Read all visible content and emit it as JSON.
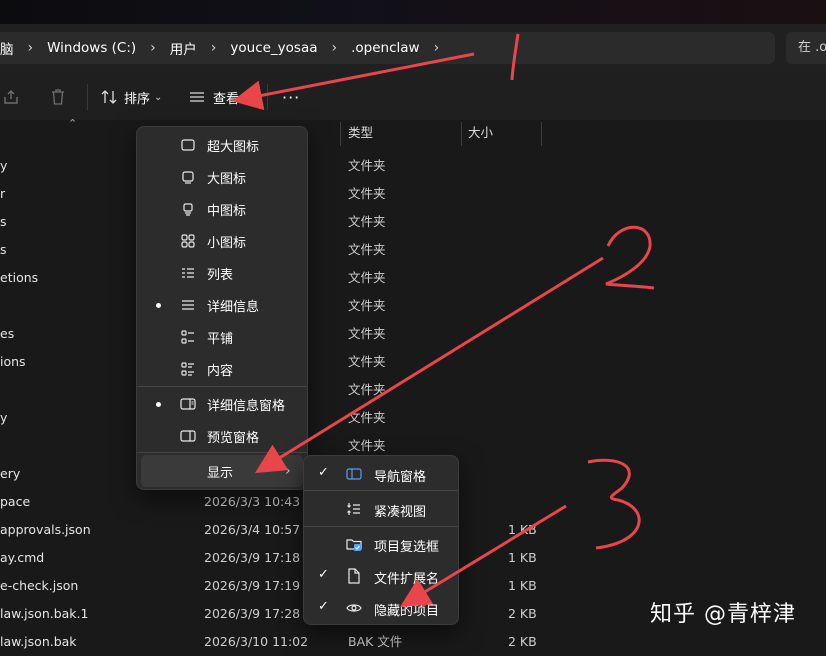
{
  "breadcrumb": {
    "items": [
      "脑",
      "Windows (C:)",
      "用户",
      "youce_yosaa",
      ".openclaw"
    ]
  },
  "search": {
    "placeholder": "在 .o"
  },
  "toolbar": {
    "sort_label": "排序",
    "view_label": "查看",
    "more_label": "···"
  },
  "columns": {
    "type": "类型",
    "size": "大小"
  },
  "rows": [
    {
      "name": "y",
      "date": "",
      "type": "文件夹",
      "size": ""
    },
    {
      "name": "r",
      "date": "",
      "type": "文件夹",
      "size": ""
    },
    {
      "name": "s",
      "date": "",
      "type": "文件夹",
      "size": ""
    },
    {
      "name": "s",
      "date": "",
      "type": "文件夹",
      "size": ""
    },
    {
      "name": "etions",
      "date": "",
      "type": "文件夹",
      "size": ""
    },
    {
      "name": "",
      "date": "",
      "type": "文件夹",
      "size": ""
    },
    {
      "name": "es",
      "date": "",
      "type": "文件夹",
      "size": ""
    },
    {
      "name": "ions",
      "date": "",
      "type": "文件夹",
      "size": ""
    },
    {
      "name": "",
      "date": "",
      "type": "文件夹",
      "size": ""
    },
    {
      "name": "y",
      "date": "",
      "type": "文件夹",
      "size": ""
    },
    {
      "name": "",
      "date": "",
      "type": "文件夹",
      "size": ""
    },
    {
      "name": "ery",
      "date": "",
      "type": "",
      "size": ""
    },
    {
      "name": "pace",
      "date": "2026/3/3 10:43",
      "type": "",
      "size": ""
    },
    {
      "name": "approvals.json",
      "date": "2026/3/4 10:57",
      "type": "",
      "size": "1 KB"
    },
    {
      "name": "ay.cmd",
      "date": "2026/3/9 17:18",
      "type": "",
      "size": "1 KB"
    },
    {
      "name": "e-check.json",
      "date": "2026/3/9 17:19",
      "type": "",
      "size": "1 KB"
    },
    {
      "name": "law.json.bak.1",
      "date": "2026/3/9 17:28",
      "type": "",
      "size": "2 KB"
    },
    {
      "name": "law.json.bak",
      "date": "2026/3/10 11:02",
      "type": "BAK 文件",
      "size": "2 KB"
    }
  ],
  "view_menu": {
    "items": [
      {
        "label": "超大图标",
        "icon": "extra-large-icons-icon",
        "dot": false
      },
      {
        "label": "大图标",
        "icon": "large-icons-icon",
        "dot": false
      },
      {
        "label": "中图标",
        "icon": "medium-icons-icon",
        "dot": false
      },
      {
        "label": "小图标",
        "icon": "small-icons-icon",
        "dot": false
      },
      {
        "label": "列表",
        "icon": "list-icon",
        "dot": false
      },
      {
        "label": "详细信息",
        "icon": "details-icon",
        "dot": true
      },
      {
        "label": "平铺",
        "icon": "tiles-icon",
        "dot": false
      },
      {
        "label": "内容",
        "icon": "content-icon",
        "dot": false
      }
    ],
    "panes": [
      {
        "label": "详细信息窗格",
        "icon": "details-pane-icon",
        "dot": true
      },
      {
        "label": "预览窗格",
        "icon": "preview-pane-icon",
        "dot": false
      }
    ],
    "show_label": "显示"
  },
  "show_submenu": {
    "items": [
      {
        "label": "导航窗格",
        "icon": "navigation-pane-icon",
        "checked": true
      },
      {
        "label": "紧凑视图",
        "icon": "compact-view-icon",
        "checked": false
      },
      {
        "label": "项目复选框",
        "icon": "item-checkbox-icon",
        "checked": false
      },
      {
        "label": "文件扩展名",
        "icon": "file-extension-icon",
        "checked": true
      },
      {
        "label": "隐藏的项目",
        "icon": "hidden-items-icon",
        "checked": true
      }
    ]
  },
  "annotations": {
    "labels": [
      "1",
      "2",
      "3"
    ],
    "color": "#e8464b"
  },
  "watermark": "知乎 @青梓津",
  "colors": {
    "background": "#191919",
    "menu": "#2c2c2c",
    "accent": "#4ea0ff"
  }
}
